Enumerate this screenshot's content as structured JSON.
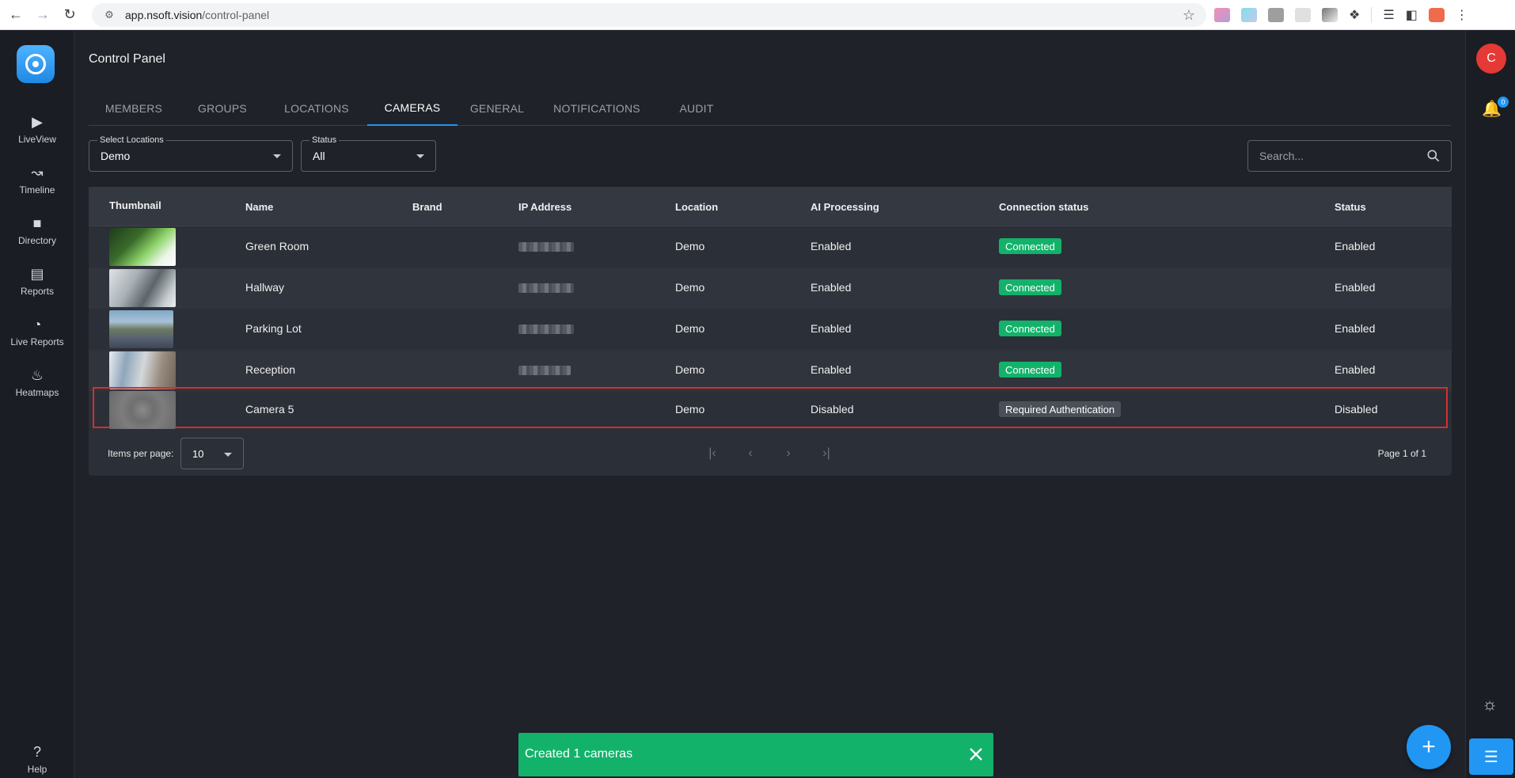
{
  "browser": {
    "url_host": "app.nsoft.vision",
    "url_path": "/control-panel"
  },
  "left_nav": {
    "items": [
      {
        "label": "LiveView",
        "icon": "tv-play-icon"
      },
      {
        "label": "Timeline",
        "icon": "trend-line-icon"
      },
      {
        "label": "Directory",
        "icon": "folder-icon"
      },
      {
        "label": "Reports",
        "icon": "document-icon"
      },
      {
        "label": "Live Reports",
        "icon": "pie-clock-icon"
      },
      {
        "label": "Heatmaps",
        "icon": "flame-icon"
      }
    ],
    "help_label": "Help"
  },
  "right_rail": {
    "avatar_initial": "C",
    "notification_count": "0"
  },
  "page": {
    "title": "Control Panel",
    "tabs": [
      {
        "label": "MEMBERS",
        "active": false
      },
      {
        "label": "GROUPS",
        "active": false
      },
      {
        "label": "LOCATIONS",
        "active": false
      },
      {
        "label": "CAMERAS",
        "active": true
      },
      {
        "label": "GENERAL",
        "active": false
      },
      {
        "label": "NOTIFICATIONS",
        "active": false
      },
      {
        "label": "AUDIT",
        "active": false
      }
    ]
  },
  "filters": {
    "locations": {
      "label": "Select Locations",
      "value": "Demo"
    },
    "status": {
      "label": "Status",
      "value": "All"
    },
    "search": {
      "placeholder": "Search..."
    }
  },
  "table": {
    "columns": [
      "Thumbnail",
      "Name",
      "Brand",
      "IP Address",
      "Location",
      "AI Processing",
      "Connection status",
      "Status"
    ],
    "rows": [
      {
        "name": "Green Room",
        "brand": "",
        "location": "Demo",
        "ai": "Enabled",
        "connection": "Connected",
        "connection_ok": true,
        "status": "Enabled"
      },
      {
        "name": "Hallway",
        "brand": "",
        "location": "Demo",
        "ai": "Enabled",
        "connection": "Connected",
        "connection_ok": true,
        "status": "Enabled"
      },
      {
        "name": "Parking Lot",
        "brand": "",
        "location": "Demo",
        "ai": "Enabled",
        "connection": "Connected",
        "connection_ok": true,
        "status": "Enabled"
      },
      {
        "name": "Reception",
        "brand": "",
        "location": "Demo",
        "ai": "Enabled",
        "connection": "Connected",
        "connection_ok": true,
        "status": "Enabled"
      },
      {
        "name": "Camera 5",
        "brand": "",
        "location": "Demo",
        "ai": "Disabled",
        "connection": "Required Authentication",
        "connection_ok": false,
        "status": "Disabled"
      }
    ],
    "items_per_page_label": "Items per page:",
    "items_per_page": "10",
    "page_info": "Page 1 of 1"
  },
  "snackbar": {
    "message": "Created 1 cameras"
  },
  "colors": {
    "accent": "#2196f3",
    "success": "#13b26b",
    "danger": "#d32f2f",
    "background": "#1f2229"
  }
}
